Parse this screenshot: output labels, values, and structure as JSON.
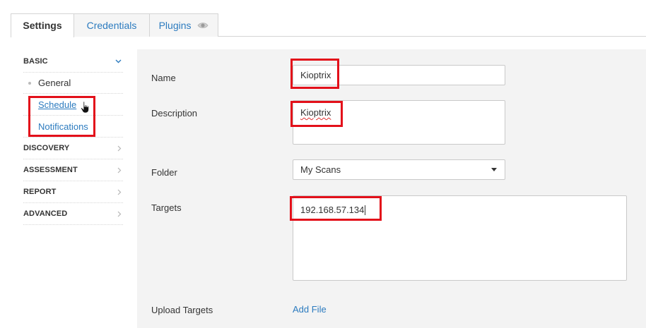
{
  "tabs": [
    {
      "label": "Settings",
      "active": true
    },
    {
      "label": "Credentials",
      "active": false
    },
    {
      "label": "Plugins",
      "active": false,
      "icon": "eye-icon"
    }
  ],
  "sidebar": {
    "basic": {
      "label": "BASIC",
      "icon": "chevron-down-icon",
      "items": [
        {
          "label": "General"
        },
        {
          "label": "Schedule"
        },
        {
          "label": "Notifications"
        }
      ]
    },
    "sections": [
      {
        "label": "DISCOVERY",
        "icon": "chevron-right-icon"
      },
      {
        "label": "ASSESSMENT",
        "icon": "chevron-right-icon"
      },
      {
        "label": "REPORT",
        "icon": "chevron-right-icon"
      },
      {
        "label": "ADVANCED",
        "icon": "chevron-right-icon"
      }
    ]
  },
  "form": {
    "name": {
      "label": "Name",
      "value": "Kioptrix"
    },
    "description": {
      "label": "Description",
      "value": "Kioptrix"
    },
    "folder": {
      "label": "Folder",
      "value": "My Scans"
    },
    "targets": {
      "label": "Targets",
      "value": "192.168.57.134"
    },
    "upload": {
      "label": "Upload Targets",
      "link": "Add File"
    }
  },
  "colors": {
    "accent": "#2c7bbf",
    "highlight": "#e3101a",
    "panel": "#f3f3f3"
  }
}
